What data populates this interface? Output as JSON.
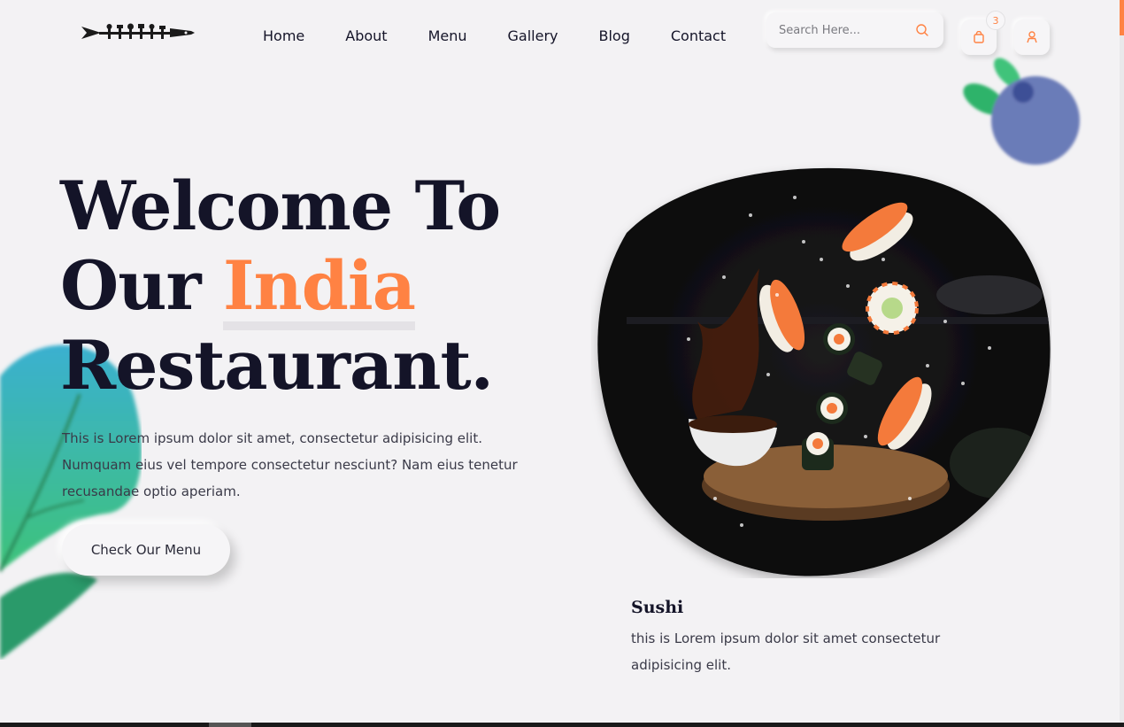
{
  "header": {
    "nav": [
      "Home",
      "About",
      "Menu",
      "Gallery",
      "Blog",
      "Contact"
    ],
    "search_placeholder": "Search Here...",
    "cart_count": "3",
    "icons": {
      "search": "search-icon",
      "cart": "shopping-bag-icon",
      "user": "user-icon",
      "logo": "cutlery-logo"
    }
  },
  "hero": {
    "title_line1": "Welcome To",
    "title_line2_prefix": "Our",
    "title_accent": "India",
    "title_line3": "Restaurant.",
    "text": "This is Lorem ipsum dolor sit amet, consectetur adipisicing elit. Numquam eius vel tempore consectetur nesciunt? Nam eius tenetur recusandae optio aperiam.",
    "button": "Check Our Menu"
  },
  "dish": {
    "name": "Sushi",
    "description": "this is Lorem ipsum dolor sit amet consectetur adipisicing elit."
  },
  "colors": {
    "accent": "#ff8243",
    "dark": "#141428",
    "background": "#f3f2f4"
  }
}
